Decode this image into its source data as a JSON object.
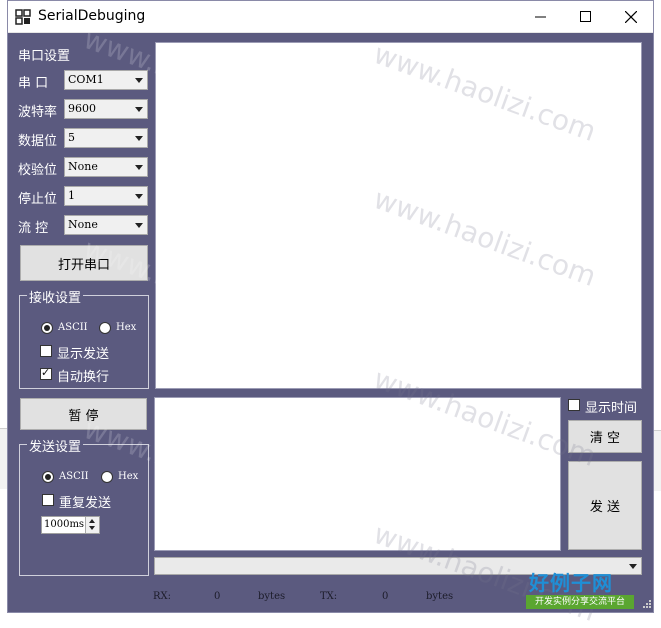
{
  "window": {
    "title": "SerialDebuging"
  },
  "serial_settings": {
    "group_label": "串口设置",
    "port_label": "串  口",
    "port_value": "COM1",
    "baud_label": "波特率",
    "baud_value": "9600",
    "databits_label": "数据位",
    "databits_value": "5",
    "parity_label": "校验位",
    "parity_value": "None",
    "stopbits_label": "停止位",
    "stopbits_value": "1",
    "flow_label": "流  控",
    "flow_value": "None",
    "open_button": "打开串口"
  },
  "receive_settings": {
    "group_label": "接收设置",
    "ascii_label": "ASCII",
    "hex_label": "Hex",
    "ascii_selected": true,
    "show_send_label": "显示发送",
    "show_send_checked": false,
    "auto_newline_label": "自动换行",
    "auto_newline_checked": true
  },
  "pause_button": "暂  停",
  "send_settings": {
    "group_label": "发送设置",
    "ascii_label": "ASCII",
    "hex_label": "Hex",
    "ascii_selected": true,
    "repeat_label": "重复发送",
    "repeat_checked": false,
    "interval_value": "1000ms"
  },
  "right_panel": {
    "show_time_label": "显示时间",
    "show_time_checked": false,
    "clear_button": "清  空",
    "send_button": "发  送"
  },
  "status_bar": {
    "rx_label": "RX:",
    "rx_value": "0",
    "rx_unit": "bytes",
    "tx_label": "TX:",
    "tx_value": "0",
    "tx_unit": "bytes"
  },
  "watermark": {
    "text": "www.haolizi.com",
    "logo_title": "好例子网",
    "logo_sub": "开发实例分享交流平台"
  },
  "colors": {
    "window_bg": "#5b5a7f",
    "titlebar": "#ffffff"
  }
}
